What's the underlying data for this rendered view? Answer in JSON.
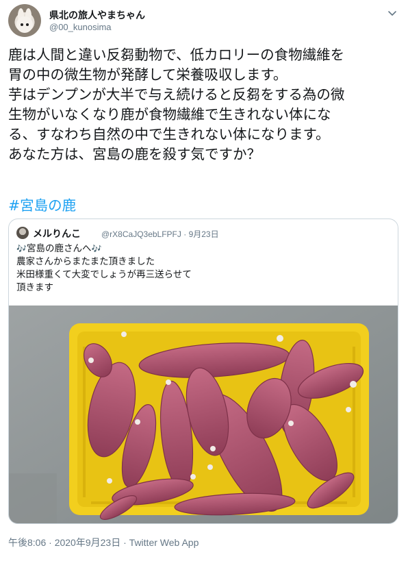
{
  "author": {
    "display_name": "県北の旅人やまちゃん",
    "handle": "@00_kunosima"
  },
  "tweet": {
    "lines": [
      "鹿は人間と違い反芻動物で、低カロリーの食物繊維を",
      "胃の中の微生物が発酵して栄養吸収します。",
      "芋はデンプンが大半で与え続けると反芻をする為の微",
      "生物がいなくなり鹿が食物繊維で生きれない体にな",
      "る、すなわち自然の中で生きれない体になります。",
      "あなた方は、宮島の鹿を殺す気ですか？"
    ],
    "hashtag": "#宮島の鹿"
  },
  "quoted_tweet": {
    "display_name": "メルりんこ",
    "handle": "@rX8CaJQ3ebLFPFJ",
    "separator": "·",
    "date": "9月23日",
    "notes_left": "🎶",
    "notes_right": "🎶",
    "line1_text": "宮島の鹿さんへ",
    "lines": [
      "農家さんからまたまた頂きました",
      "米田様重くて大変でしょうが再三送らせて",
      "頂きます"
    ],
    "photo_description": "sweet-potatoes-in-yellow-crate"
  },
  "footer": {
    "time": "午後8:06",
    "separator1": "·",
    "date": "2020年9月23日",
    "separator2": "·",
    "source": "Twitter Web App"
  },
  "colors": {
    "link": "#1da1f2",
    "text": "#14171a",
    "muted": "#657786",
    "border": "#ccd6dd",
    "crate": "#f3cf1c",
    "potato": "#b35570"
  }
}
